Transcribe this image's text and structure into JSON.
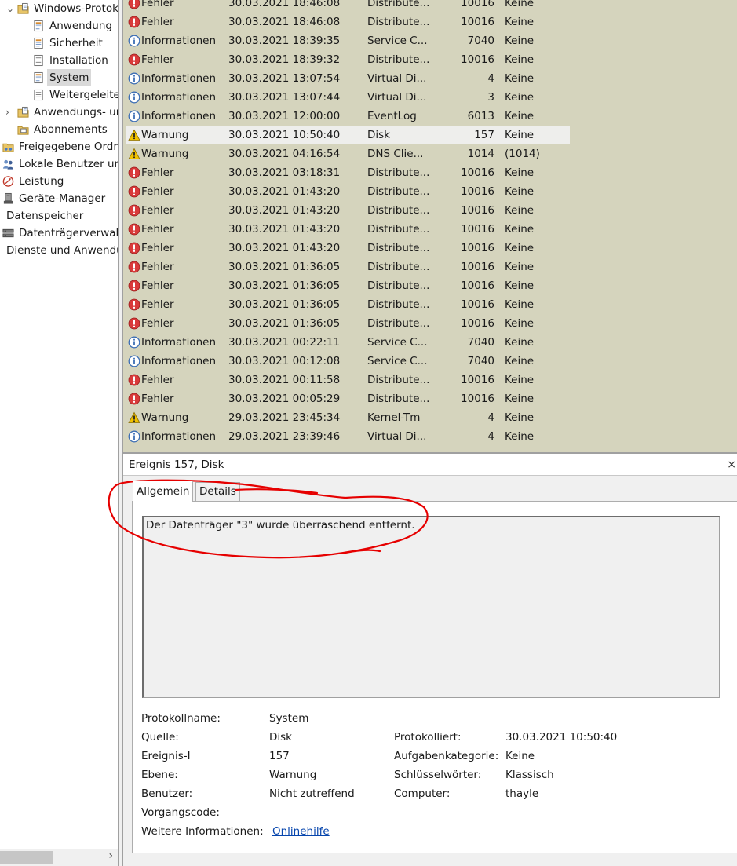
{
  "tree": {
    "items": [
      {
        "label": "Windows-Protokolle",
        "icon": "folder-log-icon",
        "expanded": true
      },
      {
        "label": "Anwendung",
        "icon": "log-icon"
      },
      {
        "label": "Sicherheit",
        "icon": "log-icon"
      },
      {
        "label": "Installation",
        "icon": "log-page-icon"
      },
      {
        "label": "System",
        "icon": "log-icon",
        "selected": true
      },
      {
        "label": "Weitergeleitete Ereignisse",
        "icon": "log-page-icon"
      },
      {
        "label": "Anwendungs- und Dienstprotokolle",
        "icon": "folder-log-icon",
        "collapsed": true
      },
      {
        "label": "Abonnements",
        "icon": "subscriptions-icon"
      },
      {
        "label": "Freigegebene Ordner",
        "icon": "shared-folder-icon"
      },
      {
        "label": "Lokale Benutzer und Gruppen",
        "icon": "users-icon"
      },
      {
        "label": "Leistung",
        "icon": "performance-icon"
      },
      {
        "label": "Geräte-Manager",
        "icon": "device-manager-icon"
      },
      {
        "label": "Datenspeicher"
      },
      {
        "label": "Datenträgerverwaltung",
        "icon": "disk-management-icon"
      },
      {
        "label": "Dienste und Anwendungen"
      }
    ]
  },
  "events": [
    {
      "level": "Fehler",
      "date": "30.03.2021 18:46:08",
      "source": "Distribute...",
      "id": "10016",
      "category": "Keine"
    },
    {
      "level": "Fehler",
      "date": "30.03.2021 18:46:08",
      "source": "Distribute...",
      "id": "10016",
      "category": "Keine"
    },
    {
      "level": "Informationen",
      "date": "30.03.2021 18:39:35",
      "source": "Service C...",
      "id": "7040",
      "category": "Keine"
    },
    {
      "level": "Fehler",
      "date": "30.03.2021 18:39:32",
      "source": "Distribute...",
      "id": "10016",
      "category": "Keine"
    },
    {
      "level": "Informationen",
      "date": "30.03.2021 13:07:54",
      "source": "Virtual Di...",
      "id": "4",
      "category": "Keine"
    },
    {
      "level": "Informationen",
      "date": "30.03.2021 13:07:44",
      "source": "Virtual Di...",
      "id": "3",
      "category": "Keine"
    },
    {
      "level": "Informationen",
      "date": "30.03.2021 12:00:00",
      "source": "EventLog",
      "id": "6013",
      "category": "Keine"
    },
    {
      "level": "Warnung",
      "date": "30.03.2021 10:50:40",
      "source": "Disk",
      "id": "157",
      "category": "Keine",
      "selected": true
    },
    {
      "level": "Warnung",
      "date": "30.03.2021 04:16:54",
      "source": "DNS Clie...",
      "id": "1014",
      "category": "(1014)"
    },
    {
      "level": "Fehler",
      "date": "30.03.2021 03:18:31",
      "source": "Distribute...",
      "id": "10016",
      "category": "Keine"
    },
    {
      "level": "Fehler",
      "date": "30.03.2021 01:43:20",
      "source": "Distribute...",
      "id": "10016",
      "category": "Keine"
    },
    {
      "level": "Fehler",
      "date": "30.03.2021 01:43:20",
      "source": "Distribute...",
      "id": "10016",
      "category": "Keine"
    },
    {
      "level": "Fehler",
      "date": "30.03.2021 01:43:20",
      "source": "Distribute...",
      "id": "10016",
      "category": "Keine"
    },
    {
      "level": "Fehler",
      "date": "30.03.2021 01:43:20",
      "source": "Distribute...",
      "id": "10016",
      "category": "Keine"
    },
    {
      "level": "Fehler",
      "date": "30.03.2021 01:36:05",
      "source": "Distribute...",
      "id": "10016",
      "category": "Keine"
    },
    {
      "level": "Fehler",
      "date": "30.03.2021 01:36:05",
      "source": "Distribute...",
      "id": "10016",
      "category": "Keine"
    },
    {
      "level": "Fehler",
      "date": "30.03.2021 01:36:05",
      "source": "Distribute...",
      "id": "10016",
      "category": "Keine"
    },
    {
      "level": "Fehler",
      "date": "30.03.2021 01:36:05",
      "source": "Distribute...",
      "id": "10016",
      "category": "Keine"
    },
    {
      "level": "Informationen",
      "date": "30.03.2021 00:22:11",
      "source": "Service C...",
      "id": "7040",
      "category": "Keine"
    },
    {
      "level": "Informationen",
      "date": "30.03.2021 00:12:08",
      "source": "Service C...",
      "id": "7040",
      "category": "Keine"
    },
    {
      "level": "Fehler",
      "date": "30.03.2021 00:11:58",
      "source": "Distribute...",
      "id": "10016",
      "category": "Keine"
    },
    {
      "level": "Fehler",
      "date": "30.03.2021 00:05:29",
      "source": "Distribute...",
      "id": "10016",
      "category": "Keine"
    },
    {
      "level": "Warnung",
      "date": "29.03.2021 23:45:34",
      "source": "Kernel-Tm",
      "id": "4",
      "category": "Keine"
    },
    {
      "level": "Informationen",
      "date": "29.03.2021 23:39:46",
      "source": "Virtual Di...",
      "id": "4",
      "category": "Keine"
    }
  ],
  "detail": {
    "title": "Ereignis 157, Disk",
    "tabs": [
      "Allgemein",
      "Details"
    ],
    "active_tab": "Allgemein",
    "message": "Der Datenträger \"3\" wurde überraschend entfernt.",
    "props": {
      "protokollname_label": "Protokollname:",
      "protokollname": "System",
      "quelle_label": "Quelle:",
      "quelle": "Disk",
      "protokolliert_label": "Protokolliert:",
      "protokolliert": "30.03.2021 10:50:40",
      "ereignis_label": "Ereignis-I",
      "ereignis": "157",
      "aufgabe_label": "Aufgabenkategorie:",
      "aufgabe": "Keine",
      "ebene_label": "Ebene:",
      "ebene": "Warnung",
      "schluessel_label": "Schlüsselwörter:",
      "schluessel": "Klassisch",
      "benutzer_label": "Benutzer:",
      "benutzer": "Nicht zutreffend",
      "computer_label": "Computer:",
      "computer": "thayle",
      "vorgang_label": "Vorgangscode:",
      "weitere_label": "Weitere Informationen:",
      "weitere_link": "Onlinehilfe"
    }
  },
  "colors": {
    "list_bg": "#d5d4bd",
    "selected_row": "#eeeeec",
    "annotation": "#e60000",
    "error": "#d93a3a",
    "info": "#3c6eb4",
    "warning": "#f2c200"
  }
}
